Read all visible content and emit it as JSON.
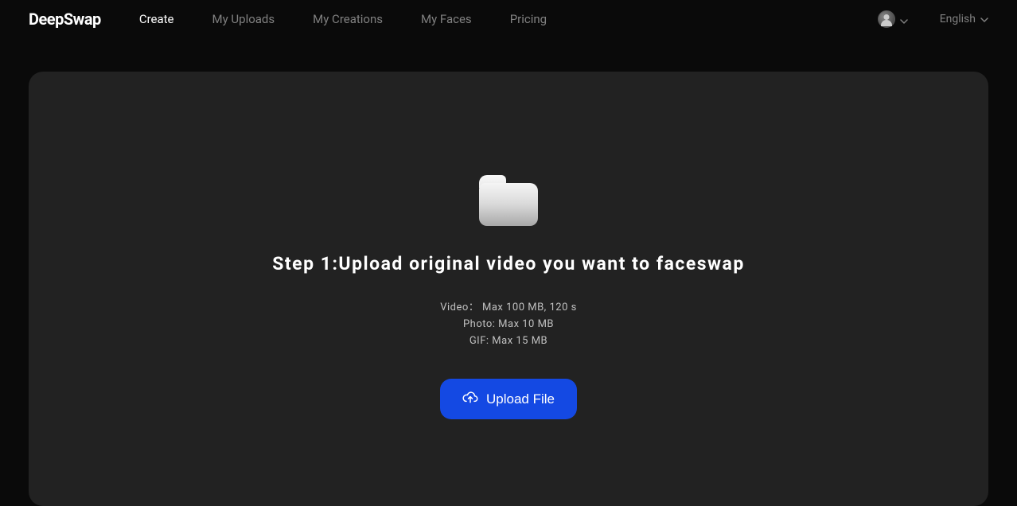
{
  "header": {
    "logo": "DeepSwap",
    "nav": {
      "create": "Create",
      "my_uploads": "My Uploads",
      "my_creations": "My Creations",
      "my_faces": "My Faces",
      "pricing": "Pricing"
    },
    "language": "English"
  },
  "main": {
    "step_title": "Step 1:Upload original video you want to faceswap",
    "limits": {
      "video": "Video： Max 100 MB, 120 s",
      "photo": "Photo: Max 10 MB",
      "gif": "GIF: Max 15 MB"
    },
    "upload_button": "Upload File"
  }
}
